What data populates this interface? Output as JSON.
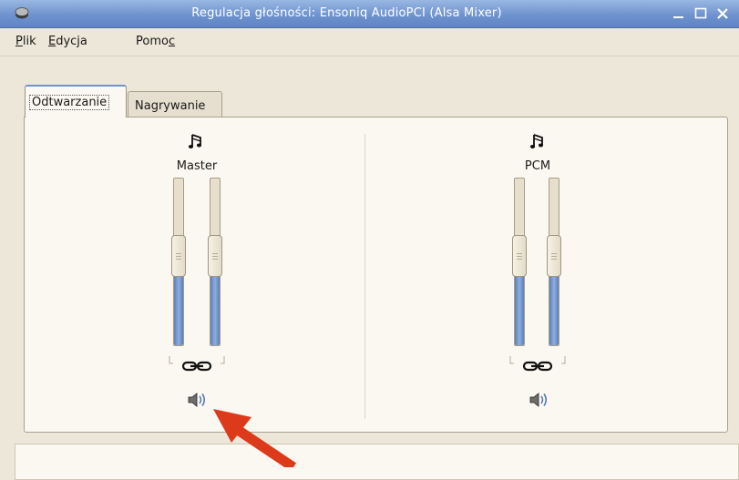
{
  "window": {
    "title": "Regulacja głośności: Ensoniq AudioPCI (Alsa Mixer)",
    "controls": [
      "minimize-icon",
      "maximize-icon",
      "close-icon"
    ]
  },
  "menu": {
    "items": [
      {
        "label": "Plik",
        "mnemonic_index": 0
      },
      {
        "label": "Edycja",
        "mnemonic_index": 0
      },
      {
        "label": "Pomoc",
        "mnemonic_index": 4
      }
    ]
  },
  "tabs": [
    {
      "label": "Odtwarzanie",
      "selected": true
    },
    {
      "label": "Nagrywanie",
      "selected": false
    }
  ],
  "channels": [
    {
      "name": "Master",
      "icon": "music-note-icon",
      "levels_percent": [
        55,
        55
      ],
      "channels_locked": true,
      "mute_icon": "speaker-icon"
    },
    {
      "name": "PCM",
      "icon": "music-note-icon",
      "levels_percent": [
        55,
        55
      ],
      "channels_locked": true,
      "mute_icon": "speaker-icon"
    }
  ],
  "colors": {
    "titlebar": "#6f93cf",
    "slider_fill": "#6f93cf",
    "annotation_arrow": "#dd3a1c"
  }
}
